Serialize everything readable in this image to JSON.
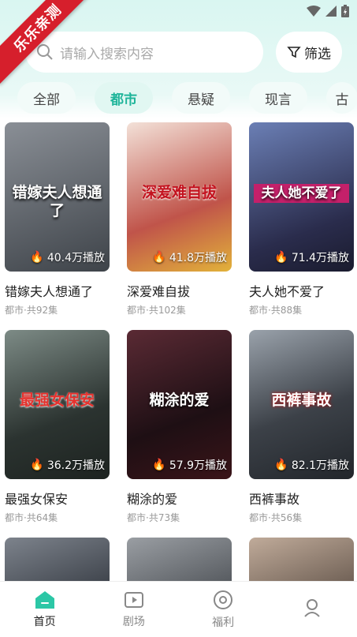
{
  "watermark": "乐乐亲测",
  "search": {
    "placeholder": "请输入搜索内容"
  },
  "filter_label": "筛选",
  "tabs": [
    "全部",
    "都市",
    "悬疑",
    "现言",
    "古"
  ],
  "dramas": [
    {
      "poster_title": "错嫁夫人想通了",
      "views": "40.4万播放",
      "title": "错嫁夫人想通了",
      "meta": "都市·共92集",
      "color": "#5a5f66"
    },
    {
      "poster_title": "深爱难自拔",
      "views": "41.8万播放",
      "title": "深爱难自拔",
      "meta": "都市·共102集",
      "color": "#b55a4a"
    },
    {
      "poster_title": "夫人她不爱了",
      "views": "71.4万播放",
      "title": "夫人她不爱了",
      "meta": "都市·共88集",
      "color": "#3d3f6b"
    },
    {
      "poster_title": "最强女保安",
      "views": "36.2万播放",
      "title": "最强女保安",
      "meta": "都市·共64集",
      "color": "#3b4a3f"
    },
    {
      "poster_title": "糊涂的爱",
      "views": "57.9万播放",
      "title": "糊涂的爱",
      "meta": "都市·共73集",
      "color": "#4a2a2e"
    },
    {
      "poster_title": "西裤事故",
      "views": "82.1万播放",
      "title": "西裤事故",
      "meta": "都市·共56集",
      "color": "#444a52"
    },
    {
      "poster_title": "",
      "views": "",
      "title": "",
      "meta": "",
      "color": "#565c66"
    },
    {
      "poster_title": "",
      "views": "",
      "title": "",
      "meta": "",
      "color": "#6b6e72"
    },
    {
      "poster_title": "",
      "views": "",
      "title": "",
      "meta": "",
      "color": "#8a7a6e"
    }
  ],
  "nav": [
    {
      "label": "首页",
      "icon": "home-icon",
      "active": true
    },
    {
      "label": "剧场",
      "icon": "theater-icon",
      "active": false
    },
    {
      "label": "福利",
      "icon": "welfare-icon",
      "active": false
    },
    {
      "label": "",
      "icon": "profile-icon",
      "active": false
    }
  ],
  "colors": {
    "accent": "#1fb59a",
    "watermark": "#d61f2c"
  }
}
